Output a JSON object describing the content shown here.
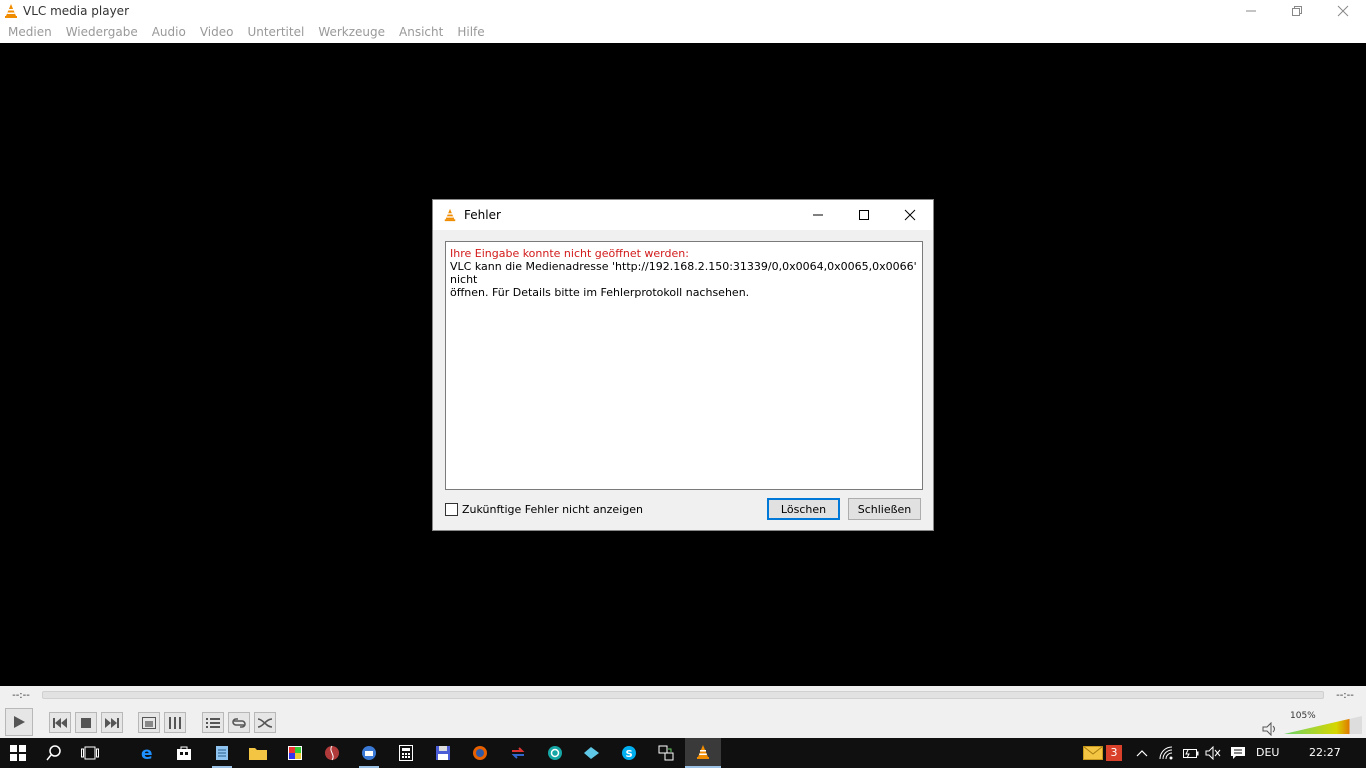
{
  "window": {
    "title": "VLC media player",
    "menu": [
      "Medien",
      "Wiedergabe",
      "Audio",
      "Video",
      "Untertitel",
      "Werkzeuge",
      "Ansicht",
      "Hilfe"
    ]
  },
  "dialog": {
    "title": "Fehler",
    "error_heading": "Ihre Eingabe konnte nicht geöffnet werden:",
    "error_body_line1": "VLC kann die Medienadresse 'http://192.168.2.150:31339/0,0x0064,0x0065,0x0066' nicht",
    "error_body_line2": "öffnen. Für Details bitte im Fehlerprotokoll nachsehen.",
    "checkbox_label": "Zukünftige Fehler nicht anzeigen",
    "checkbox_checked": false,
    "clear_button": "Löschen",
    "close_button": "Schließen"
  },
  "player": {
    "elapsed": "--:--",
    "remaining": "--:--",
    "volume": "105%",
    "volume_level": 1.05
  },
  "taskbar": {
    "language": "DEU",
    "clock": "22:27",
    "mail_count": "3"
  },
  "colors": {
    "error_text": "#d21a1a",
    "accent": "#0078d7",
    "vlc_orange": "#f08c00"
  }
}
